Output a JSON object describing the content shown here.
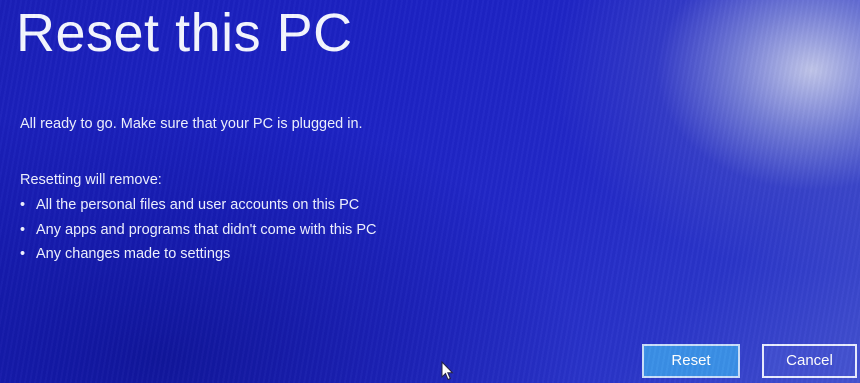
{
  "window": {
    "title": "Reset this PC"
  },
  "message": {
    "ready": "All ready to go. Make sure that your PC is plugged in.",
    "remove_heading": "Resetting will remove:",
    "remove_items": [
      "All the personal files and user accounts on this PC",
      "Any apps and programs that didn't come with this PC",
      "Any changes made to settings"
    ],
    "bullet": "•"
  },
  "actions": {
    "reset_label": "Reset",
    "cancel_label": "Cancel"
  },
  "icons": {
    "cursor": "mouse-pointer-icon"
  },
  "colors": {
    "background": "#1c22c4",
    "text": "#eef1ff",
    "reset_button": "#3a8fe6",
    "cancel_border": "#e8ecff"
  }
}
